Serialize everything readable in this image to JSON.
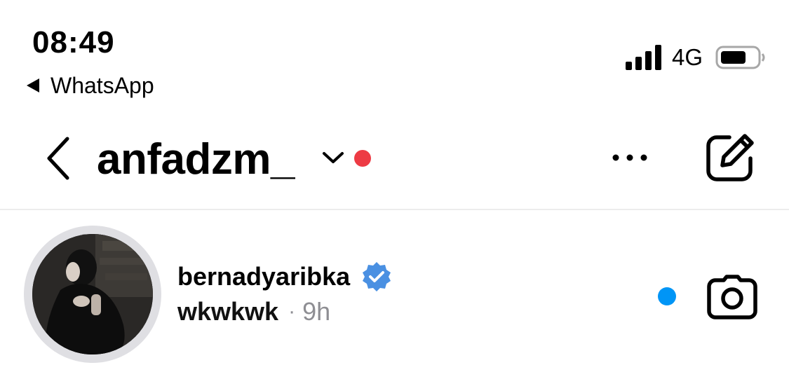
{
  "status_bar": {
    "time": "08:49",
    "back_app_label": "WhatsApp",
    "network": "4G",
    "signal_icon": "cellular-signal-icon",
    "battery_icon": "battery-icon"
  },
  "header": {
    "username": "anfadzm_",
    "back_icon": "chevron-left-icon",
    "dropdown_icon": "chevron-down-icon",
    "notification_dot_color": "#ed3b44",
    "more_icon": "ellipsis-icon",
    "compose_icon": "new-message-icon"
  },
  "threads": [
    {
      "name": "bernadyaribka",
      "verified": true,
      "verified_color": "#4a90e2",
      "last_message": "wkwkwk",
      "separator": "·",
      "time_ago": "9h",
      "unread": true,
      "unread_color": "#0095f6",
      "camera_icon": "camera-icon"
    }
  ]
}
